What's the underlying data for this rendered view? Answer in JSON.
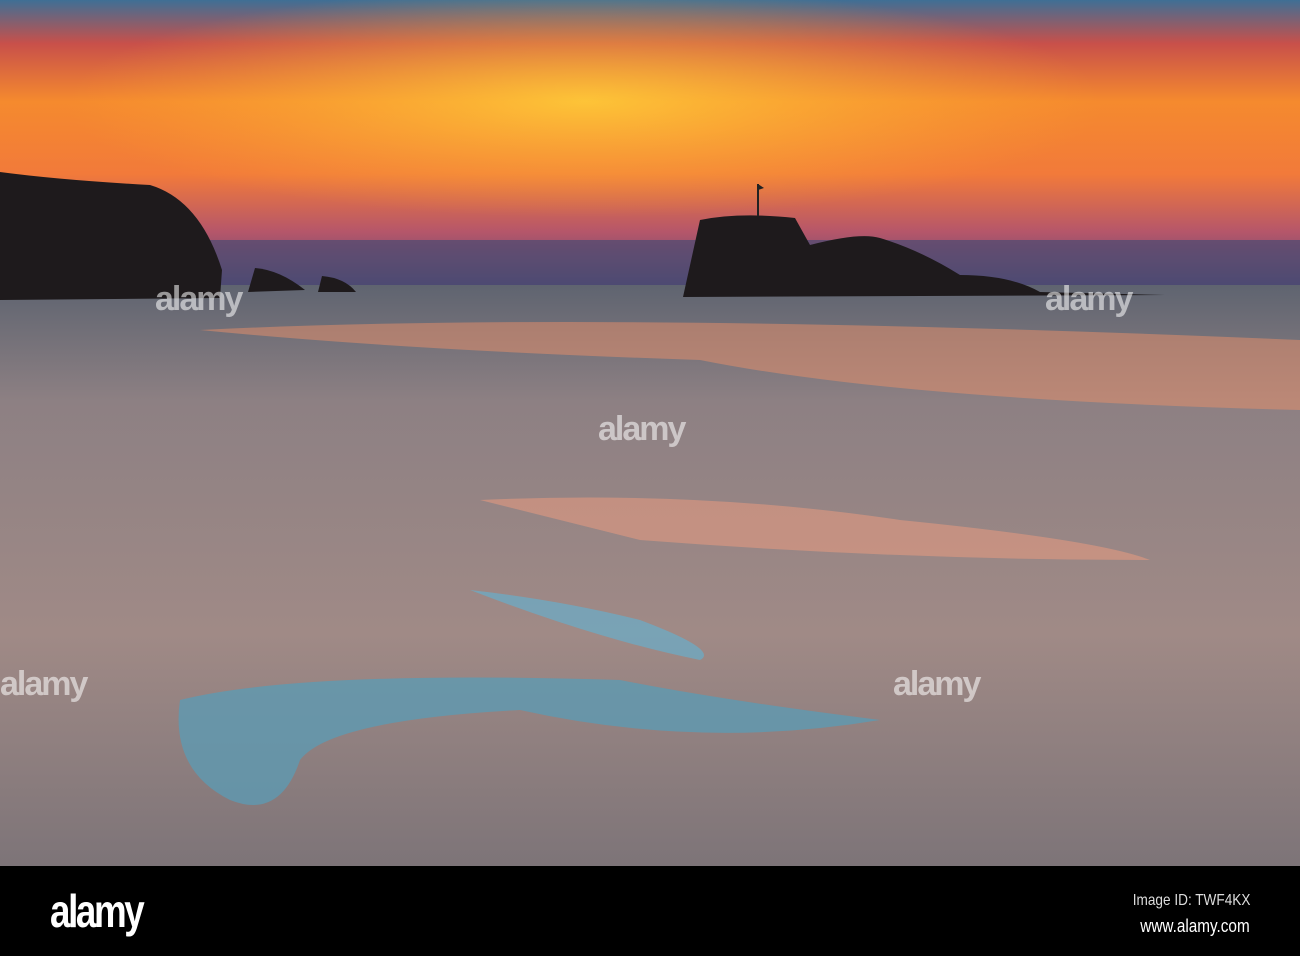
{
  "photo": {
    "subject": "Sunset over beach with rock stacks and tidal pools"
  },
  "watermark": {
    "text": "alamy"
  },
  "footer": {
    "logo": "alamy",
    "image_id": "Image ID: TWF4KX",
    "website": "www.alamy.com"
  }
}
